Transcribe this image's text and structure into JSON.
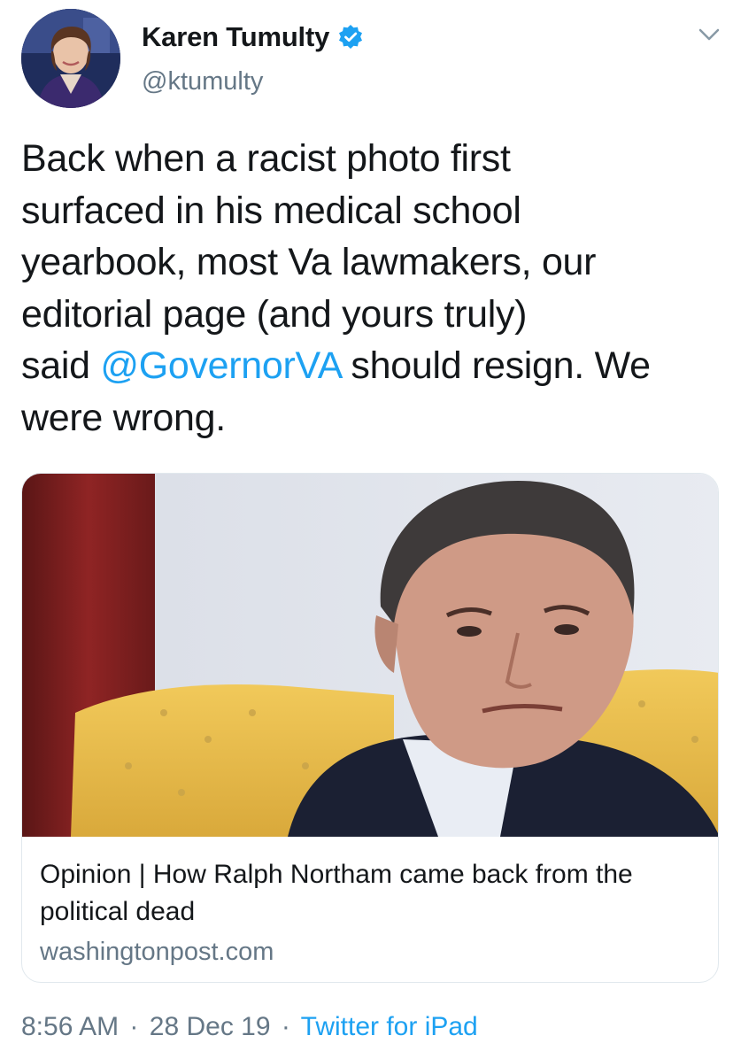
{
  "author": {
    "name": "Karen Tumulty",
    "handle": "@ktumulty",
    "verified": true,
    "icons": {
      "verified": "verified-badge-icon",
      "menu": "chevron-down-icon"
    }
  },
  "tweet": {
    "text_lines": [
      "Back when a racist photo first",
      "surfaced in his medical school",
      "yearbook, most Va lawmakers, our",
      "editorial page (and yours truly)"
    ],
    "line5_prefix": "said ",
    "mention": "@GovernorVA",
    "line5_suffix": " should resign. We",
    "line6": "were wrong."
  },
  "link_card": {
    "title": "Opinion | How Ralph Northam came back from the political dead",
    "domain": "washingtonpost.com"
  },
  "meta": {
    "time": "8:56 AM",
    "separator": "·",
    "date": "28 Dec 19",
    "source": "Twitter for iPad"
  },
  "colors": {
    "link_blue": "#1da1f2",
    "secondary_text": "#657786",
    "primary_text": "#14171a",
    "border": "#e1e8ed"
  }
}
